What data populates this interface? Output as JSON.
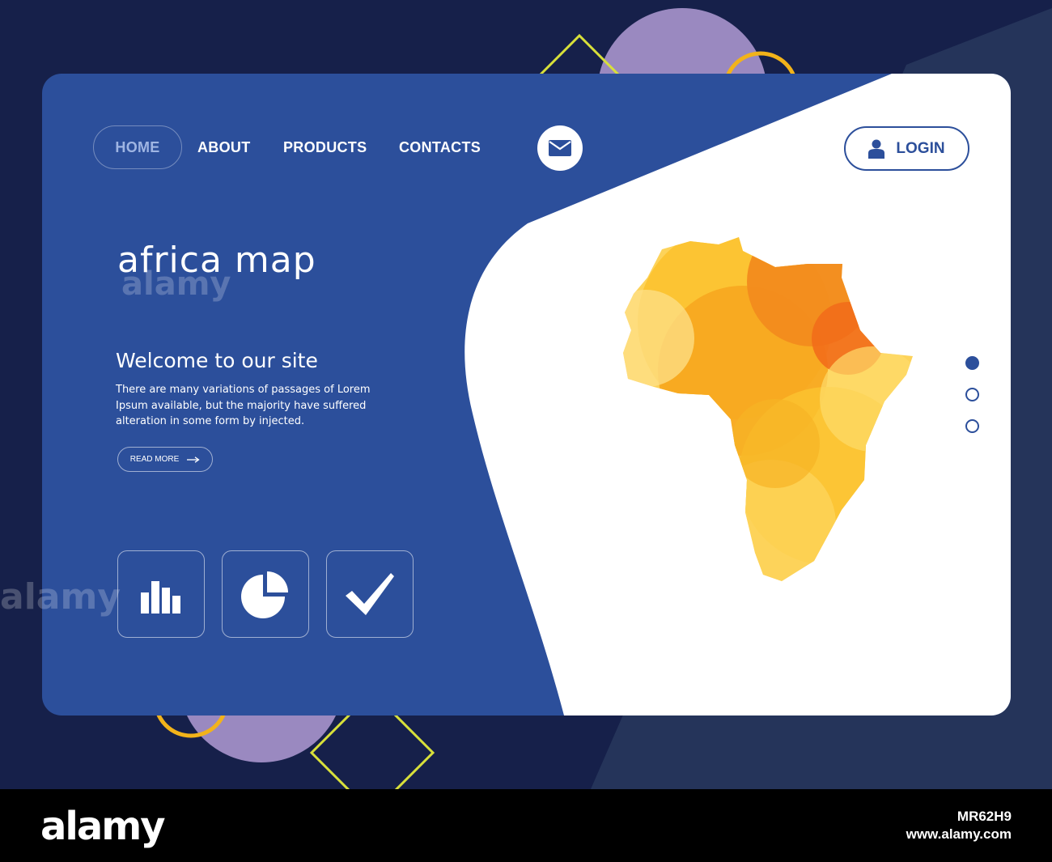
{
  "nav": {
    "items": [
      {
        "label": "HOME",
        "active": true
      },
      {
        "label": "ABOUT"
      },
      {
        "label": "PRODUCTS"
      },
      {
        "label": "CONTACTS"
      }
    ],
    "mail_icon": "envelope-icon",
    "login_label": "LOGIN",
    "login_icon": "user-icon"
  },
  "hero": {
    "headline": "africa map",
    "welcome": "Welcome to our site",
    "body": "There are many variations of passages of Lorem Ipsum available, but the majority have suffered alteration in some form by injected.",
    "read_more_label": "READ MORE",
    "read_more_icon": "arrow-right-icon"
  },
  "features": [
    {
      "icon": "bar-chart-icon"
    },
    {
      "icon": "pie-chart-icon"
    },
    {
      "icon": "checkmark-icon"
    }
  ],
  "slider": {
    "count": 3,
    "active_index": 0
  },
  "map": {
    "name": "africa",
    "icon": "africa-map-icon"
  },
  "watermark": {
    "brand": "alamy",
    "stock_id": "MR62H9",
    "url": "www.alamy.com"
  },
  "colors": {
    "page_bg": "#16204a",
    "card_blue": "#2c4f9b",
    "card_white": "#ffffff",
    "accent_yellow": "#f7c42a",
    "accent_orange": "#f28b1e",
    "decor_purple": "#9a89c0",
    "decor_lime": "#d8e03a"
  }
}
